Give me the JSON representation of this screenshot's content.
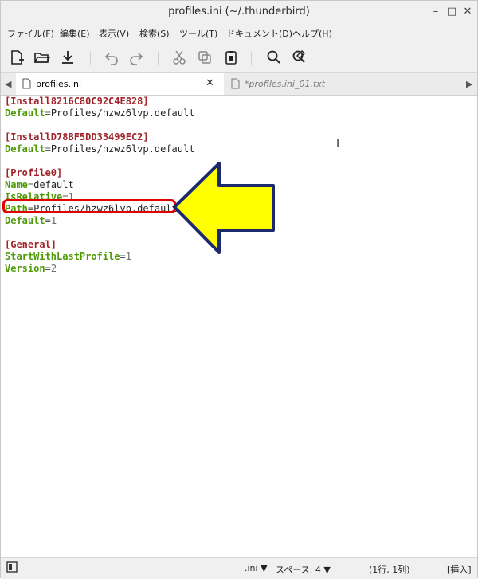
{
  "window": {
    "title": "profiles.ini (~/.thunderbird)"
  },
  "menubar": {
    "items": [
      "ファイル(F)",
      "編集(E)",
      "表示(V)",
      "検索(S)",
      "ツール(T)",
      "ドキュメント(D)",
      "ヘルプ(H)"
    ]
  },
  "toolbar": {
    "icons": [
      "new-file-icon",
      "open-icon",
      "save-icon",
      "undo-icon",
      "redo-icon",
      "cut-icon",
      "copy-icon",
      "paste-icon",
      "search-icon",
      "replace-icon"
    ]
  },
  "tabs": [
    {
      "label": "profiles.ini",
      "active": true
    },
    {
      "label": "*profiles.ini_01.txt",
      "active": false
    }
  ],
  "editor": {
    "lines": [
      {
        "type": "section",
        "text": "[Install8216C80C92C4E828]"
      },
      {
        "type": "kv",
        "key": "Default",
        "value": "Profiles/hzwz6lvp.default"
      },
      {
        "type": "blank"
      },
      {
        "type": "section",
        "text": "[InstallD78BF5DD33499EC2]"
      },
      {
        "type": "kv",
        "key": "Default",
        "value": "Profiles/hzwz6lvp.default"
      },
      {
        "type": "blank"
      },
      {
        "type": "section",
        "text": "[Profile0]"
      },
      {
        "type": "kv",
        "key": "Name",
        "value": "default"
      },
      {
        "type": "kv",
        "key": "IsRelative",
        "value": "1",
        "numeric": true
      },
      {
        "type": "kv",
        "key": "Path",
        "value": "Profiles/hzwz6lvp.default",
        "highlighted": true
      },
      {
        "type": "kv",
        "key": "Default",
        "value": "1",
        "numeric": true
      },
      {
        "type": "blank"
      },
      {
        "type": "section",
        "text": "[General]"
      },
      {
        "type": "kv",
        "key": "StartWithLastProfile",
        "value": "1",
        "numeric": true
      },
      {
        "type": "kv",
        "key": "Version",
        "value": "2",
        "numeric": true
      }
    ]
  },
  "annotation": {
    "highlight_color": "#e10000",
    "arrow_fill": "#ffff00",
    "arrow_stroke": "#1a2a6c"
  },
  "statusbar": {
    "syntax": ".ini ▼",
    "spaces": "スペース: 4 ▼",
    "position": "(1行, 1列)",
    "mode": "[挿入]"
  },
  "colors": {
    "section": "#a0242a",
    "key": "#4e9a06",
    "number": "#6b6b6b"
  }
}
